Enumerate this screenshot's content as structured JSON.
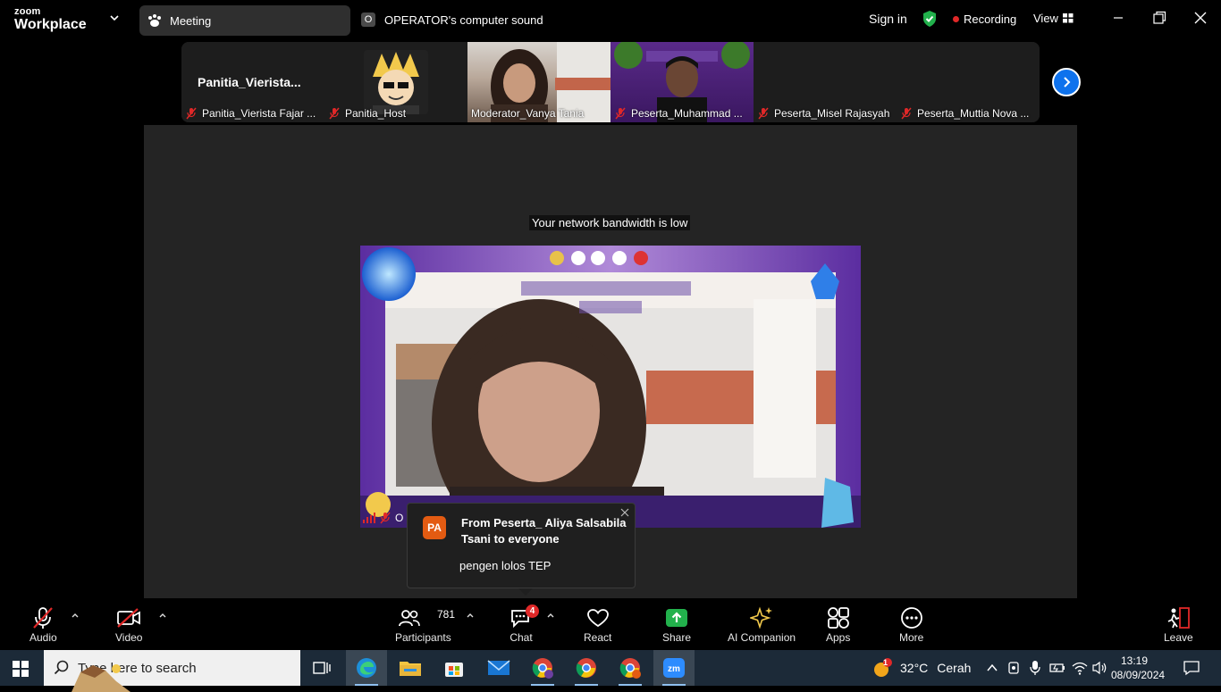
{
  "titlebar": {
    "brand_top": "zoom",
    "brand_bottom": "Workplace",
    "meeting_tab": "Meeting",
    "operator_initial": "O",
    "operator_sound": "OPERATOR's computer sound",
    "sign_in": "Sign in",
    "recording": "Recording",
    "view": "View"
  },
  "gallery": {
    "tiles": [
      {
        "name": "Panitia_Vierista Fajar ...",
        "big_name": "Panitia_Vierista..."
      },
      {
        "name": "Panitia_Host"
      },
      {
        "name": "Moderator_Vanya Tania"
      },
      {
        "name": "Peserta_Muhammad ..."
      },
      {
        "name": "Peserta_Misel Rajasyah"
      },
      {
        "name": "Peserta_Muttia Nova ..."
      }
    ]
  },
  "stage": {
    "bandwidth_notice": "Your network bandwidth is low",
    "video_name_fragment": "O"
  },
  "notification": {
    "avatar": "PA",
    "from": "From Peserta_ Aliya Salsabila Tsani to everyone",
    "message": "pengen lolos TEP"
  },
  "toolbar": {
    "audio": "Audio",
    "video": "Video",
    "participants": "Participants",
    "participants_count": "781",
    "chat": "Chat",
    "chat_badge": "4",
    "react": "React",
    "share": "Share",
    "ai_companion": "AI Companion",
    "apps": "Apps",
    "more": "More",
    "leave": "Leave"
  },
  "taskbar": {
    "search_placeholder": "Type here to search",
    "weather_temp": "32°C",
    "weather_desc": "Cerah",
    "weather_badge": "1",
    "time": "13:19",
    "date": "08/09/2024"
  },
  "colors": {
    "accent_blue": "#0e72ed",
    "recording_red": "#e02828",
    "share_green": "#22b14c",
    "ai_gold": "#f2c94c",
    "leave_red": "#e02828"
  }
}
